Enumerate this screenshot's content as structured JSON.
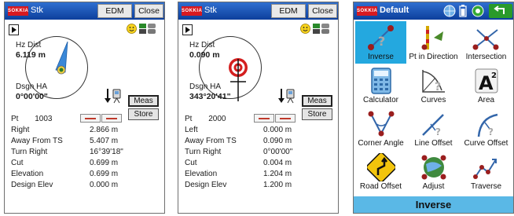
{
  "screen1": {
    "titlebar": {
      "logo": "SOKKIA",
      "title": "Stk",
      "edm_label": "EDM",
      "close_label": "Close"
    },
    "hz_dist_label": "Hz Dist",
    "hz_dist_value": "6.119 m",
    "dsgn_ha_label": "Dsgn HA",
    "dsgn_ha_value": "0°00'00\"",
    "meas_label": "Meas",
    "store_label": "Store",
    "pt_label": "Pt",
    "pt_value": "1003",
    "rows": [
      {
        "label": "Right",
        "value": "2.866 m"
      },
      {
        "label": "Away From TS",
        "value": "5.407 m"
      },
      {
        "label": "Turn Right",
        "value": "16°39'18\""
      },
      {
        "label": "Cut",
        "value": "0.699 m"
      },
      {
        "label": "Elevation",
        "value": "0.699 m"
      },
      {
        "label": "Design Elev",
        "value": "0.000 m"
      }
    ]
  },
  "screen2": {
    "titlebar": {
      "logo": "SOKKIA",
      "title": "Stk",
      "edm_label": "EDM",
      "close_label": "Close"
    },
    "hz_dist_label": "Hz Dist",
    "hz_dist_value": "0.090 m",
    "dsgn_ha_label": "Dsgn HA",
    "dsgn_ha_value": "343°20'41\"",
    "meas_label": "Meas",
    "store_label": "Store",
    "pt_label": "Pt",
    "pt_value": "2000",
    "rows": [
      {
        "label": "Left",
        "value": "0.000 m"
      },
      {
        "label": "Away From TS",
        "value": "0.090 m"
      },
      {
        "label": "Turn Right",
        "value": "0°00'00\""
      },
      {
        "label": "Cut",
        "value": "0.004 m"
      },
      {
        "label": "Elevation",
        "value": "1.204 m"
      },
      {
        "label": "Design Elev",
        "value": "1.200 m"
      }
    ]
  },
  "screen3": {
    "titlebar": {
      "logo": "SOKKIA",
      "title": "Default"
    },
    "menu": [
      {
        "label": "Inverse",
        "icon": "inverse-icon"
      },
      {
        "label": "Pt in Direction",
        "icon": "pt-in-direction-icon"
      },
      {
        "label": "Intersection",
        "icon": "intersection-icon"
      },
      {
        "label": "Calculator",
        "icon": "calculator-icon"
      },
      {
        "label": "Curves",
        "icon": "curves-icon"
      },
      {
        "label": "Area",
        "icon": "area-icon"
      },
      {
        "label": "Corner Angle",
        "icon": "corner-angle-icon"
      },
      {
        "label": "Line Offset",
        "icon": "line-offset-icon"
      },
      {
        "label": "Curve Offset",
        "icon": "curve-offset-icon"
      },
      {
        "label": "Road Offset",
        "icon": "road-offset-icon"
      },
      {
        "label": "Adjust",
        "icon": "adjust-icon"
      },
      {
        "label": "Traverse",
        "icon": "traverse-icon"
      }
    ],
    "area_glyph": "A",
    "area_superscript": "2",
    "status_label": "Inverse"
  },
  "colors": {
    "title_bar": "#0d3f9c",
    "selection": "#24a8df",
    "status_bar": "#5ab8e6",
    "logo": "#d71920",
    "target_red": "#d41f1f"
  }
}
